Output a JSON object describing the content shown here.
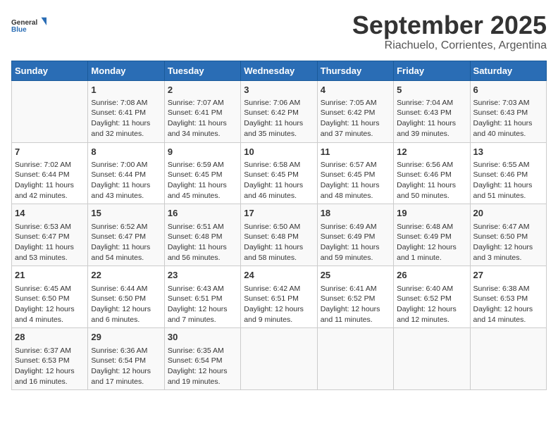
{
  "header": {
    "logo_general": "General",
    "logo_blue": "Blue",
    "title": "September 2025",
    "subtitle": "Riachuelo, Corrientes, Argentina"
  },
  "days_of_week": [
    "Sunday",
    "Monday",
    "Tuesday",
    "Wednesday",
    "Thursday",
    "Friday",
    "Saturday"
  ],
  "weeks": [
    [
      {
        "day": "",
        "content": ""
      },
      {
        "day": "1",
        "content": "Sunrise: 7:08 AM\nSunset: 6:41 PM\nDaylight: 11 hours\nand 32 minutes."
      },
      {
        "day": "2",
        "content": "Sunrise: 7:07 AM\nSunset: 6:41 PM\nDaylight: 11 hours\nand 34 minutes."
      },
      {
        "day": "3",
        "content": "Sunrise: 7:06 AM\nSunset: 6:42 PM\nDaylight: 11 hours\nand 35 minutes."
      },
      {
        "day": "4",
        "content": "Sunrise: 7:05 AM\nSunset: 6:42 PM\nDaylight: 11 hours\nand 37 minutes."
      },
      {
        "day": "5",
        "content": "Sunrise: 7:04 AM\nSunset: 6:43 PM\nDaylight: 11 hours\nand 39 minutes."
      },
      {
        "day": "6",
        "content": "Sunrise: 7:03 AM\nSunset: 6:43 PM\nDaylight: 11 hours\nand 40 minutes."
      }
    ],
    [
      {
        "day": "7",
        "content": "Sunrise: 7:02 AM\nSunset: 6:44 PM\nDaylight: 11 hours\nand 42 minutes."
      },
      {
        "day": "8",
        "content": "Sunrise: 7:00 AM\nSunset: 6:44 PM\nDaylight: 11 hours\nand 43 minutes."
      },
      {
        "day": "9",
        "content": "Sunrise: 6:59 AM\nSunset: 6:45 PM\nDaylight: 11 hours\nand 45 minutes."
      },
      {
        "day": "10",
        "content": "Sunrise: 6:58 AM\nSunset: 6:45 PM\nDaylight: 11 hours\nand 46 minutes."
      },
      {
        "day": "11",
        "content": "Sunrise: 6:57 AM\nSunset: 6:45 PM\nDaylight: 11 hours\nand 48 minutes."
      },
      {
        "day": "12",
        "content": "Sunrise: 6:56 AM\nSunset: 6:46 PM\nDaylight: 11 hours\nand 50 minutes."
      },
      {
        "day": "13",
        "content": "Sunrise: 6:55 AM\nSunset: 6:46 PM\nDaylight: 11 hours\nand 51 minutes."
      }
    ],
    [
      {
        "day": "14",
        "content": "Sunrise: 6:53 AM\nSunset: 6:47 PM\nDaylight: 11 hours\nand 53 minutes."
      },
      {
        "day": "15",
        "content": "Sunrise: 6:52 AM\nSunset: 6:47 PM\nDaylight: 11 hours\nand 54 minutes."
      },
      {
        "day": "16",
        "content": "Sunrise: 6:51 AM\nSunset: 6:48 PM\nDaylight: 11 hours\nand 56 minutes."
      },
      {
        "day": "17",
        "content": "Sunrise: 6:50 AM\nSunset: 6:48 PM\nDaylight: 11 hours\nand 58 minutes."
      },
      {
        "day": "18",
        "content": "Sunrise: 6:49 AM\nSunset: 6:49 PM\nDaylight: 11 hours\nand 59 minutes."
      },
      {
        "day": "19",
        "content": "Sunrise: 6:48 AM\nSunset: 6:49 PM\nDaylight: 12 hours\nand 1 minute."
      },
      {
        "day": "20",
        "content": "Sunrise: 6:47 AM\nSunset: 6:50 PM\nDaylight: 12 hours\nand 3 minutes."
      }
    ],
    [
      {
        "day": "21",
        "content": "Sunrise: 6:45 AM\nSunset: 6:50 PM\nDaylight: 12 hours\nand 4 minutes."
      },
      {
        "day": "22",
        "content": "Sunrise: 6:44 AM\nSunset: 6:50 PM\nDaylight: 12 hours\nand 6 minutes."
      },
      {
        "day": "23",
        "content": "Sunrise: 6:43 AM\nSunset: 6:51 PM\nDaylight: 12 hours\nand 7 minutes."
      },
      {
        "day": "24",
        "content": "Sunrise: 6:42 AM\nSunset: 6:51 PM\nDaylight: 12 hours\nand 9 minutes."
      },
      {
        "day": "25",
        "content": "Sunrise: 6:41 AM\nSunset: 6:52 PM\nDaylight: 12 hours\nand 11 minutes."
      },
      {
        "day": "26",
        "content": "Sunrise: 6:40 AM\nSunset: 6:52 PM\nDaylight: 12 hours\nand 12 minutes."
      },
      {
        "day": "27",
        "content": "Sunrise: 6:38 AM\nSunset: 6:53 PM\nDaylight: 12 hours\nand 14 minutes."
      }
    ],
    [
      {
        "day": "28",
        "content": "Sunrise: 6:37 AM\nSunset: 6:53 PM\nDaylight: 12 hours\nand 16 minutes."
      },
      {
        "day": "29",
        "content": "Sunrise: 6:36 AM\nSunset: 6:54 PM\nDaylight: 12 hours\nand 17 minutes."
      },
      {
        "day": "30",
        "content": "Sunrise: 6:35 AM\nSunset: 6:54 PM\nDaylight: 12 hours\nand 19 minutes."
      },
      {
        "day": "",
        "content": ""
      },
      {
        "day": "",
        "content": ""
      },
      {
        "day": "",
        "content": ""
      },
      {
        "day": "",
        "content": ""
      }
    ]
  ]
}
